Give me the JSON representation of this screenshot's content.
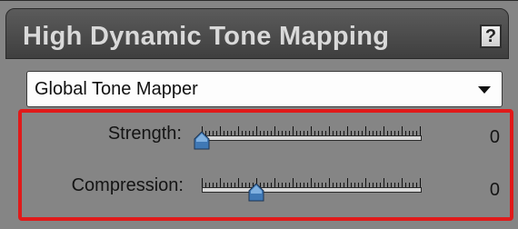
{
  "panel": {
    "title": "High Dynamic Tone Mapping",
    "help_label": "?"
  },
  "mapper": {
    "selected": "Global Tone Mapper"
  },
  "sliders": {
    "strength": {
      "label": "Strength:",
      "value": "0",
      "position": 0.0
    },
    "compression": {
      "label": "Compression:",
      "value": "0",
      "position": 0.25
    }
  },
  "colors": {
    "highlight": "#e01a1a",
    "thumb": "#3f78b5"
  }
}
